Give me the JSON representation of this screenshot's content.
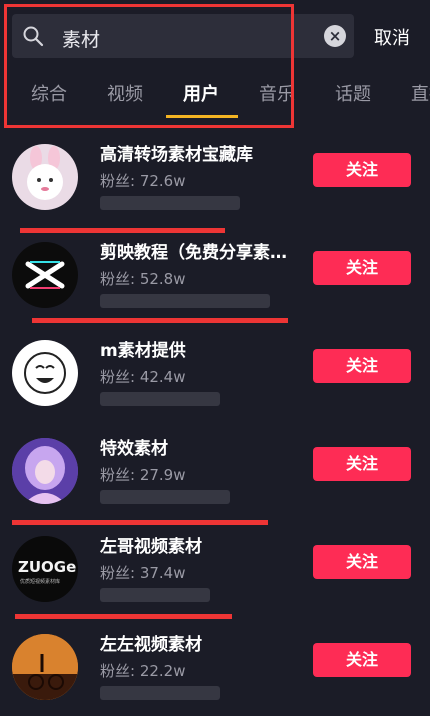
{
  "search": {
    "query": "素材",
    "cancel_label": "取消"
  },
  "tabs": [
    {
      "label": "综合"
    },
    {
      "label": "视频"
    },
    {
      "label": "用户"
    },
    {
      "label": "音乐"
    },
    {
      "label": "话题"
    },
    {
      "label": "直播"
    }
  ],
  "active_tab": "用户",
  "users": [
    {
      "name": "高清转场素材宝藏库",
      "fans": "粉丝: 72.6w",
      "follow_label": "关注"
    },
    {
      "name": "剪映教程（免费分享素材）",
      "fans": "粉丝: 52.8w",
      "follow_label": "关注"
    },
    {
      "name": "m素材提供",
      "fans": "粉丝: 42.4w",
      "follow_label": "关注"
    },
    {
      "name": "特效素材",
      "fans": "粉丝: 27.9w",
      "follow_label": "关注"
    },
    {
      "name": "左哥视频素材",
      "fans": "粉丝: 37.4w",
      "follow_label": "关注"
    },
    {
      "name": "左左视频素材",
      "fans": "粉丝: 22.2w",
      "follow_label": "关注"
    }
  ],
  "avatar_logos": {
    "zuoge": "ZUOGe",
    "zuoge_sub": "优质短视频素材库"
  },
  "colors": {
    "accent": "#fe2c55",
    "tab_underline": "#f4b423",
    "annotation": "#ee3535",
    "background": "#1b1c27"
  }
}
